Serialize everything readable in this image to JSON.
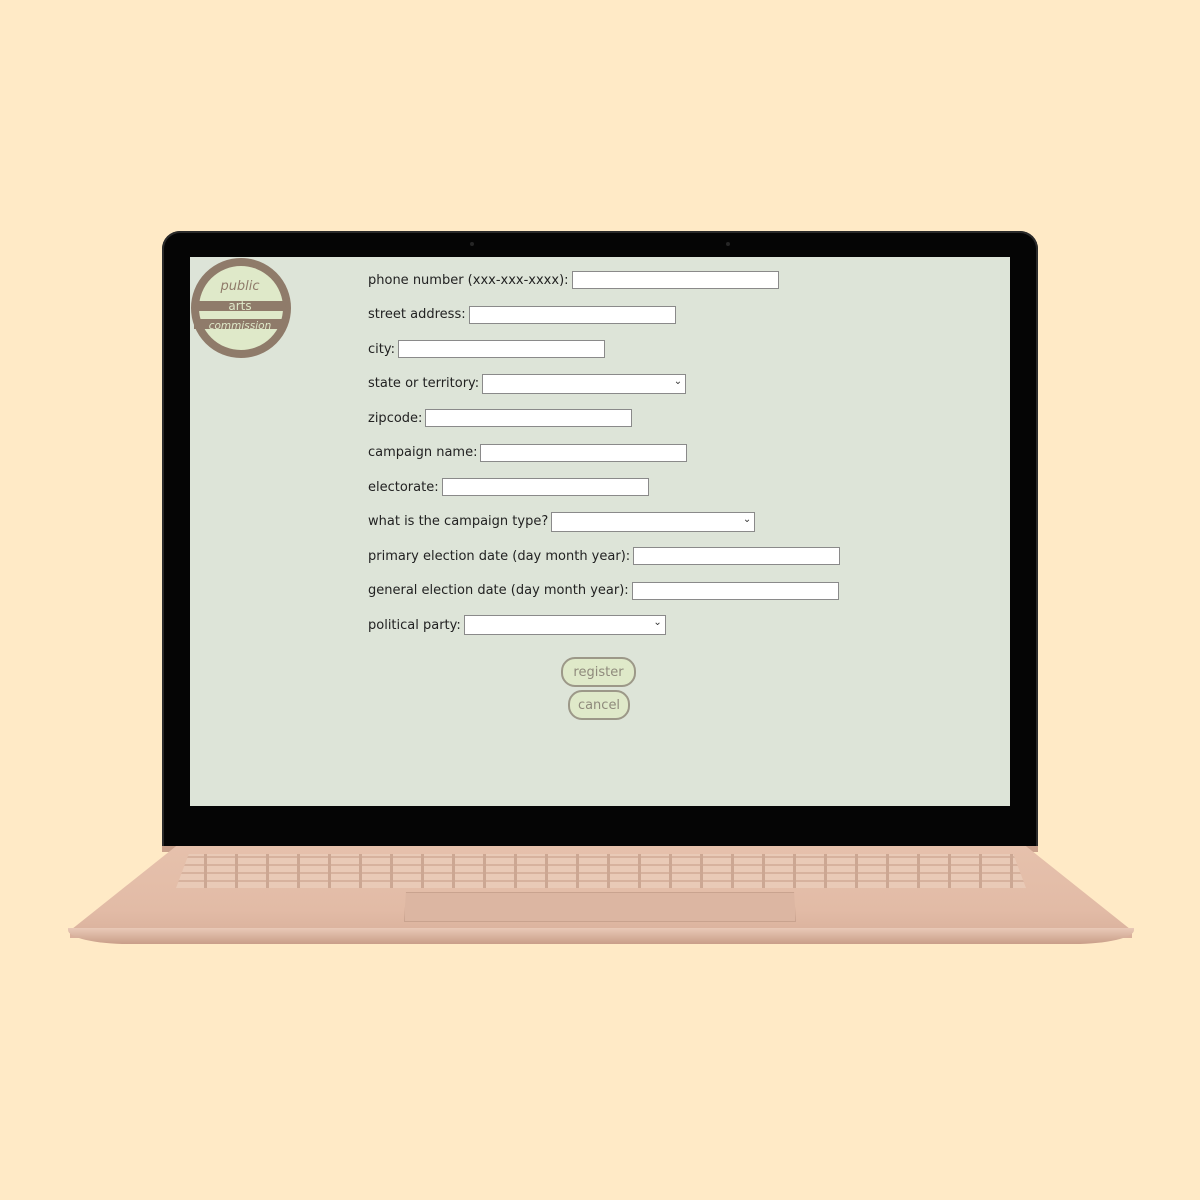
{
  "logo": {
    "line1": "public",
    "line2": "arts",
    "line3": "commission"
  },
  "form": {
    "fields": [
      {
        "label": "phone number (xxx-xxx-xxxx):",
        "value": ""
      },
      {
        "label": "street address:",
        "value": ""
      },
      {
        "label": "city:",
        "value": ""
      },
      {
        "label": "state or territory:",
        "selected": ""
      },
      {
        "label": "zipcode:",
        "value": ""
      },
      {
        "label": "campaign name:",
        "value": ""
      },
      {
        "label": "electorate:",
        "value": ""
      },
      {
        "label": "what is the campaign type?",
        "selected": ""
      },
      {
        "label": "primary election date (day month year):",
        "value": ""
      },
      {
        "label": "general election date (day month year):",
        "value": ""
      },
      {
        "label": "political party:",
        "selected": ""
      }
    ]
  },
  "buttons": {
    "register": "register",
    "cancel": "cancel"
  },
  "icons": {
    "dropdown": "chevron-down-icon"
  },
  "colors": {
    "page_bg": "#ffeac6",
    "screen_bg": "#dde4d8",
    "button_fill": "#dfe9c9",
    "logo_ring": "#8f7b6a",
    "logo_fill": "#dfe9c9"
  }
}
